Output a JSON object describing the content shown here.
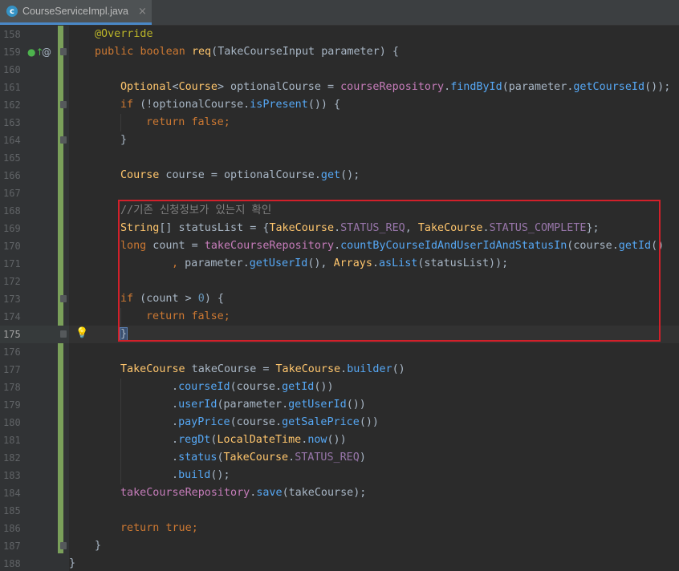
{
  "tab": {
    "file_name": "CourseServiceImpl.java",
    "icon_letter": "c",
    "close_glyph": "×"
  },
  "editor": {
    "lines": [
      {
        "n": "158"
      },
      {
        "n": "159"
      },
      {
        "n": "160"
      },
      {
        "n": "161"
      },
      {
        "n": "162"
      },
      {
        "n": "163"
      },
      {
        "n": "164"
      },
      {
        "n": "165"
      },
      {
        "n": "166"
      },
      {
        "n": "167"
      },
      {
        "n": "168"
      },
      {
        "n": "169"
      },
      {
        "n": "170"
      },
      {
        "n": "171"
      },
      {
        "n": "172"
      },
      {
        "n": "173"
      },
      {
        "n": "174"
      },
      {
        "n": "175"
      },
      {
        "n": "176"
      },
      {
        "n": "177"
      },
      {
        "n": "178"
      },
      {
        "n": "179"
      },
      {
        "n": "180"
      },
      {
        "n": "181"
      },
      {
        "n": "182"
      },
      {
        "n": "183"
      },
      {
        "n": "184"
      },
      {
        "n": "185"
      },
      {
        "n": "186"
      },
      {
        "n": "187"
      },
      {
        "n": "188"
      }
    ],
    "current_line": "175",
    "code": {
      "l158": "@Override",
      "l159_public": "public",
      "l159_boolean": "boolean",
      "l159_name": "req",
      "l159_open": "(",
      "l159_type": "TakeCourseInput",
      "l159_param": "parameter",
      "l159_close": ") {",
      "l161_optional": "Optional",
      "l161_lt": "<",
      "l161_course": "Course",
      "l161_gt": "> optionalCourse = ",
      "l161_repo": "courseRepository",
      "l161_dot1": ".",
      "l161_find": "findById",
      "l161_open": "(",
      "l161_param": "parameter",
      "l161_dot2": ".",
      "l161_get": "getCourseId",
      "l161_end": "());",
      "l162_if": "if",
      "l162_mid": " (!optionalCourse.",
      "l162_is": "isPresent",
      "l162_end": "()) {",
      "l163_return": "return",
      "l163_false": "false",
      "l163_semi": ";",
      "l164": "}",
      "l166_type": "Course",
      "l166_mid": " course = optionalCourse.",
      "l166_get": "get",
      "l166_end": "();",
      "l168": "//기존 신청정보가 있는지 확인",
      "l169_type": "String",
      "l169_mid": "[] statusList = {",
      "l169_tc1": "TakeCourse",
      "l169_dot1": ".",
      "l169_f1": "STATUS_REQ",
      "l169_comma": ", ",
      "l169_tc2": "TakeCourse",
      "l169_dot2": ".",
      "l169_f2": "STATUS_COMPLETE",
      "l169_end": "};",
      "l170_long": "long",
      "l170_mid": " count = ",
      "l170_repo": "takeCourseRepository",
      "l170_dot": ".",
      "l170_method": "countByCourseIdAndUserIdAndStatusIn",
      "l170_open": "(course.",
      "l170_getid": "getId",
      "l170_end": "()",
      "l171_comma": ", ",
      "l171_param": "parameter",
      "l171_dot": ".",
      "l171_getuser": "getUserId",
      "l171_mid": "(), ",
      "l171_arrays": "Arrays",
      "l171_dot2": ".",
      "l171_aslist": "asList",
      "l171_end": "(statusList));",
      "l173_if": "if",
      "l173_mid": " (count > ",
      "l173_num": "0",
      "l173_end": ") {",
      "l174_return": "return",
      "l174_false": "false",
      "l174_semi": ";",
      "l175": "}",
      "l177_type": "TakeCourse",
      "l177_mid": " takeCourse = ",
      "l177_tc": "TakeCourse",
      "l177_dot": ".",
      "l177_builder": "builder",
      "l177_end": "()",
      "l178_dot": ".",
      "l178_m": "courseId",
      "l178_mid": "(course.",
      "l178_get": "getId",
      "l178_end": "())",
      "l179_dot": ".",
      "l179_m": "userId",
      "l179_open": "(",
      "l179_param": "parameter",
      "l179_dot2": ".",
      "l179_get": "getUserId",
      "l179_end": "())",
      "l180_dot": ".",
      "l180_m": "payPrice",
      "l180_mid": "(course.",
      "l180_get": "getSalePrice",
      "l180_end": "())",
      "l181_dot": ".",
      "l181_m": "regDt",
      "l181_open": "(",
      "l181_ldt": "LocalDateTime",
      "l181_dot2": ".",
      "l181_now": "now",
      "l181_end": "())",
      "l182_dot": ".",
      "l182_m": "status",
      "l182_open": "(",
      "l182_tc": "TakeCourse",
      "l182_dot2": ".",
      "l182_f": "STATUS_REQ",
      "l182_end": ")",
      "l183_dot": ".",
      "l183_m": "build",
      "l183_end": "();",
      "l184_repo": "takeCourseRepository",
      "l184_dot": ".",
      "l184_save": "save",
      "l184_end": "(takeCourse);",
      "l186_return": "return",
      "l186_true": "true",
      "l186_semi": ";",
      "l187": "}",
      "l188": "}"
    }
  },
  "gutter_icons": {
    "override": "override-up-arrow-icon",
    "annotation": "at-sign-icon",
    "bulb": "lightbulb-icon"
  },
  "colors": {
    "background": "#2b2b2b",
    "keyword": "#cc7832",
    "annotation": "#bbb529",
    "highlight_box": "#d2202a",
    "change_bar": "#7aa05a"
  }
}
